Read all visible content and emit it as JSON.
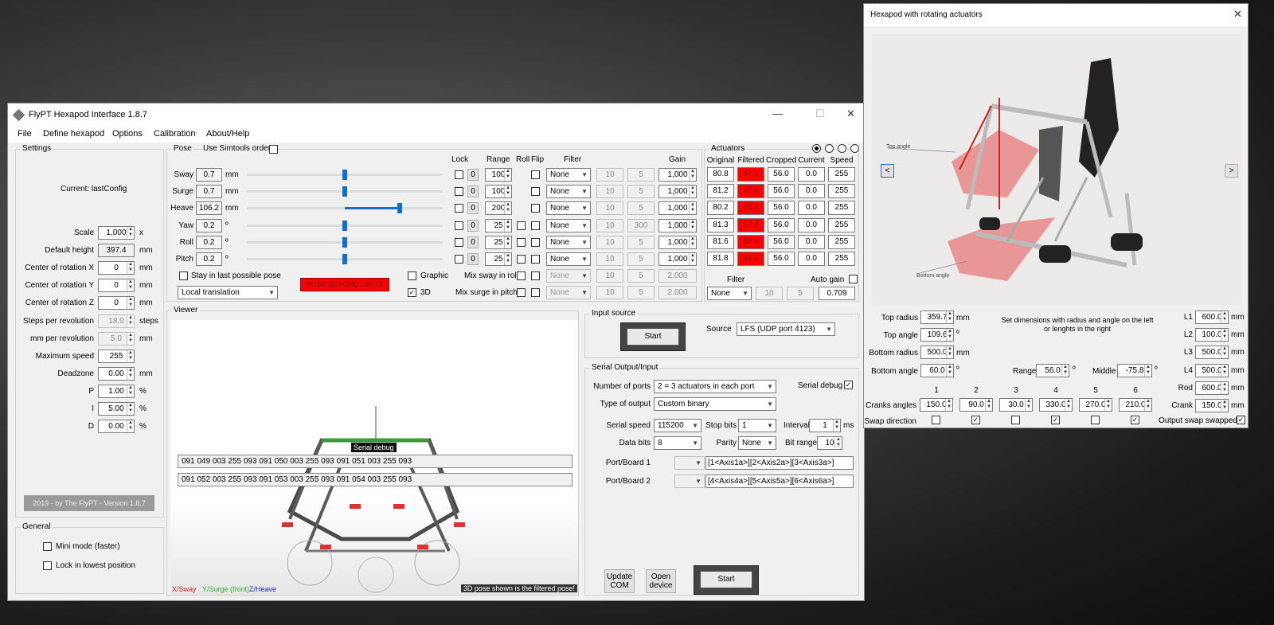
{
  "main": {
    "title": "FlyPT Hexapod Interface 1.8.7",
    "menu": [
      "File",
      "Define hexapod",
      "Options",
      "Calibration",
      "About/Help"
    ],
    "settings": {
      "group": "Settings",
      "current": "Current: lastConfig",
      "rows": [
        {
          "label": "Scale",
          "value": "1,000",
          "unit": "x"
        },
        {
          "label": "Default height",
          "value": "397.4",
          "unit": "mm"
        },
        {
          "label": "Center of rotation X",
          "value": "0",
          "unit": "mm"
        },
        {
          "label": "Center of rotation Y",
          "value": "0",
          "unit": "mm"
        },
        {
          "label": "Center of rotation Z",
          "value": "0",
          "unit": "mm"
        },
        {
          "label": "Steps per revolution",
          "value": "18.0",
          "unit": "steps"
        },
        {
          "label": "mm per revolution",
          "value": "5.0",
          "unit": "mm"
        },
        {
          "label": "Maximum speed",
          "value": "255",
          "unit": ""
        },
        {
          "label": "Deadzone",
          "value": "0.00",
          "unit": "mm"
        },
        {
          "label": "P",
          "value": "1.00",
          "unit": "%"
        },
        {
          "label": "I",
          "value": "5.00",
          "unit": "%"
        },
        {
          "label": "D",
          "value": "0.00",
          "unit": "%"
        }
      ],
      "footer": "2019 - by The FlyPT - Version 1.8.7"
    },
    "general": {
      "group": "General",
      "mini": "Mini mode (faster)",
      "lock": "Lock in lowest position"
    },
    "pose": {
      "group": "Pose",
      "simtools": "Use Simtools order",
      "headers": {
        "lock": "Lock",
        "range": "Range",
        "roll": "Roll",
        "flip": "Flip",
        "filter": "Filter",
        "gain": "Gain"
      },
      "rows": [
        {
          "label": "Sway",
          "value": "0.7",
          "unit": "mm",
          "lockv": "0",
          "range": "100",
          "filter": "None",
          "f1": "10",
          "f2": "5",
          "gain": "1,000",
          "pos": 0.5
        },
        {
          "label": "Surge",
          "value": "0.7",
          "unit": "mm",
          "lockv": "0",
          "range": "100",
          "filter": "None",
          "f1": "10",
          "f2": "5",
          "gain": "1,000",
          "pos": 0.5
        },
        {
          "label": "Heave",
          "value": "106.2",
          "unit": "mm",
          "lockv": "0",
          "range": "200",
          "filter": "None",
          "f1": "10",
          "f2": "5",
          "gain": "1,000",
          "pos": 0.78
        },
        {
          "label": "Yaw",
          "value": "0.2",
          "unit": "º",
          "lockv": "0",
          "range": "25",
          "filter": "None",
          "f1": "10",
          "f2": "300",
          "gain": "1,000",
          "pos": 0.5
        },
        {
          "label": "Roll",
          "value": "0.2",
          "unit": "º",
          "lockv": "0",
          "range": "25",
          "filter": "None",
          "f1": "10",
          "f2": "5",
          "gain": "1,000",
          "pos": 0.5
        },
        {
          "label": "Pitch",
          "value": "0.2",
          "unit": "º",
          "lockv": "0",
          "range": "25",
          "filter": "None",
          "f1": "10",
          "f2": "5",
          "gain": "1,000",
          "pos": 0.5
        }
      ],
      "stay": "Stay in last possible pose",
      "translation": "Local translation",
      "beyond": "POSE BEYOND LIMITS",
      "graphic": "Graphic",
      "three_d": "3D",
      "mix_sway": "Mix sway in roll",
      "mix_surge": "Mix surge in pitch",
      "mix_sway_vals": {
        "f": "None",
        "a": "10",
        "b": "5",
        "g": "2.000"
      },
      "mix_surge_vals": {
        "f": "None",
        "a": "10",
        "b": "5",
        "g": "2.000"
      }
    },
    "actuators": {
      "group": "Actuators",
      "headers": [
        "Original",
        "Filtered",
        "Cropped",
        "Current",
        "Speed"
      ],
      "rows": [
        [
          "80.8",
          "57.3",
          "56.0",
          "0.0",
          "255"
        ],
        [
          "81.2",
          "57.6",
          "56.0",
          "0.0",
          "255"
        ],
        [
          "80.2",
          "56.8",
          "56.0",
          "0.0",
          "255"
        ],
        [
          "81.3",
          "57.7",
          "56.0",
          "0.0",
          "255"
        ],
        [
          "81.6",
          "57.9",
          "56.0",
          "0.0",
          "255"
        ],
        [
          "81.8",
          "58.0",
          "56.0",
          "0.0",
          "255"
        ]
      ],
      "filter_label": "Filter",
      "autogain": "Auto gain",
      "filter": "None",
      "f1": "10",
      "f2": "5",
      "gain": "0.709"
    },
    "viewer": {
      "group": "Viewer",
      "serial_debug": "Serial debug",
      "line1": "091 049 003 255 093 091 050 003 255 093 091 051 003 255 093",
      "line2": "091 052 003 255 093 091 053 003 255 093 091 054 003 255 093",
      "x": "X/Sway",
      "y": "Y/Surge (front)",
      "z": "Z/Heave",
      "note": "3D pose shown is the filtered pose!"
    },
    "input": {
      "group": "Input source",
      "start": "Start",
      "source_label": "Source",
      "source": "LFS (UDP port 4123)"
    },
    "serial": {
      "group": "Serial Output/Input",
      "ports_label": "Number of ports",
      "ports": "2 = 3 actuators in each port",
      "debug": "Serial debug",
      "type_label": "Type of output",
      "type": "Custom binary",
      "speed_label": "Serial speed",
      "speed": "115200",
      "stop_label": "Stop bits",
      "stop": "1",
      "interval_label": "Interval",
      "interval": "1",
      "interval_unit": "ms",
      "data_label": "Data bits",
      "data": "8",
      "parity_label": "Parity",
      "parity": "None",
      "bitrange_label": "Bit range",
      "bitrange": "10",
      "port1_label": "Port/Board 1",
      "port1": "[1<Axis1a>][2<Axis2a>][3<Axis3a>]",
      "port2_label": "Port/Board 2",
      "port2": "[4<Axis4a>][5<Axis5a>][6<Axis6a>]",
      "update": "Update COM",
      "open": "Open device",
      "start": "Start"
    }
  },
  "hex": {
    "title": "Hexapod with rotating actuators",
    "top_angle_note": "Top angle",
    "bottom_angle_note": "Bottom angle",
    "top_radius_label": "Top radius",
    "top_radius": "359.7",
    "mm": "mm",
    "deg": "º",
    "top_angle_label": "Top angle",
    "top_angle": "109.6",
    "bottom_radius_label": "Bottom radius",
    "bottom_radius": "500.0",
    "bottom_angle_label": "Bottom angle",
    "bottom_angle": "60.0",
    "hint": "Set dimensions with radius and angle on the left or lenghts in the right",
    "range_label": "Range",
    "range": "56.0",
    "middle_label": "Middle",
    "middle": "-75.8",
    "L1_label": "L1",
    "L1": "600.0",
    "L2_label": "L2",
    "L2": "100.0",
    "L3_label": "L3",
    "L3": "500.0",
    "L4_label": "L4",
    "L4": "500.0",
    "rod_label": "Rod",
    "rod": "600.0",
    "crank_label": "Crank",
    "crank": "150.0",
    "crank_heads": [
      "1",
      "2",
      "3",
      "4",
      "5",
      "6"
    ],
    "cranks_label": "Cranks angles",
    "cranks": [
      "150.0",
      "90.0",
      "30.0",
      "330.0",
      "270.0",
      "210.0"
    ],
    "swap_label": "Swap direction",
    "swap": [
      false,
      true,
      false,
      true,
      false,
      true
    ],
    "output_swap": "Output swap swapped"
  }
}
